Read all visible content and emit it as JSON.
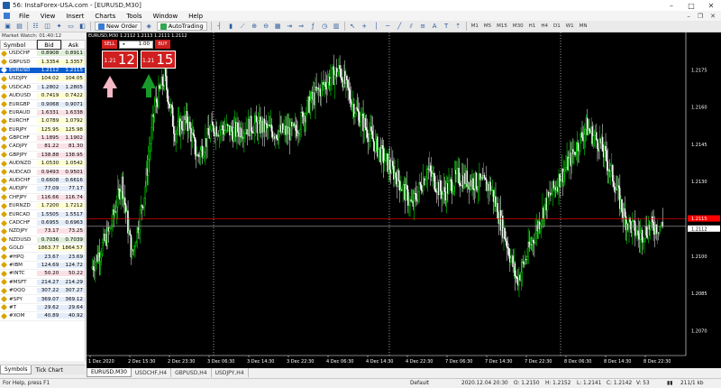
{
  "window": {
    "title": "56: InstaForex-USA.com - [EURUSD,M30]"
  },
  "menu": [
    "File",
    "View",
    "Insert",
    "Charts",
    "Tools",
    "Window",
    "Help"
  ],
  "toolbar": {
    "new_order": "New Order",
    "auto_trading": "AutoTrading",
    "timeframes": [
      "M1",
      "M5",
      "M15",
      "M30",
      "H1",
      "H4",
      "D1",
      "W1",
      "MN"
    ]
  },
  "market_watch": {
    "title": "Market Watch: 01:40:12",
    "headers": {
      "symbol": "Symbol",
      "bid": "Bid",
      "ask": "Ask"
    },
    "rows": [
      {
        "symbol": "USDCHF",
        "bid": "0.8908",
        "ask": "0.8911",
        "bg": "#dff0d8"
      },
      {
        "symbol": "GBPUSD",
        "bid": "1.3354",
        "ask": "1.3357",
        "bg": "#ffffd0"
      },
      {
        "symbol": "EURUSD",
        "bid": "1.2112",
        "ask": "1.2115",
        "bg": "#0a5dcf",
        "selected": true
      },
      {
        "symbol": "USDJPY",
        "bid": "104.02",
        "ask": "104.05",
        "bg": "#ffffd0"
      },
      {
        "symbol": "USDCAD",
        "bid": "1.2802",
        "ask": "1.2805",
        "bg": "#e3ecfa"
      },
      {
        "symbol": "AUDUSD",
        "bid": "0.7419",
        "ask": "0.7422",
        "bg": "#ffffd0"
      },
      {
        "symbol": "EURGBP",
        "bid": "0.9068",
        "ask": "0.9071",
        "bg": "#e3ecfa"
      },
      {
        "symbol": "EURAUD",
        "bid": "1.6331",
        "ask": "1.6338",
        "bg": "#fbe0e6"
      },
      {
        "symbol": "EURCHF",
        "bid": "1.0789",
        "ask": "1.0792",
        "bg": "#ffffd0"
      },
      {
        "symbol": "EURJPY",
        "bid": "125.95",
        "ask": "125.98",
        "bg": "#ffffd0"
      },
      {
        "symbol": "GBPCHF",
        "bid": "1.1895",
        "ask": "1.1902",
        "bg": "#fbe0e6"
      },
      {
        "symbol": "CADJPY",
        "bid": "81.22",
        "ask": "81.30",
        "bg": "#fbe0e6"
      },
      {
        "symbol": "GBPJPY",
        "bid": "138.88",
        "ask": "138.95",
        "bg": "#fbe0e6"
      },
      {
        "symbol": "AUDNZD",
        "bid": "1.0530",
        "ask": "1.0542",
        "bg": "#ffffd0"
      },
      {
        "symbol": "AUDCAD",
        "bid": "0.9493",
        "ask": "0.9501",
        "bg": "#fbe0e6"
      },
      {
        "symbol": "AUDCHF",
        "bid": "0.6608",
        "ask": "0.6616",
        "bg": "#e3ecfa"
      },
      {
        "symbol": "AUDJPY",
        "bid": "77.09",
        "ask": "77.17",
        "bg": "#e3ecfa"
      },
      {
        "symbol": "CHFJPY",
        "bid": "116.66",
        "ask": "116.74",
        "bg": "#fbe0e6"
      },
      {
        "symbol": "EURNZD",
        "bid": "1.7200",
        "ask": "1.7212",
        "bg": "#ffffd0"
      },
      {
        "symbol": "EURCAD",
        "bid": "1.5505",
        "ask": "1.5517",
        "bg": "#e3ecfa"
      },
      {
        "symbol": "CADCHF",
        "bid": "0.6955",
        "ask": "0.6963",
        "bg": "#e3ecfa"
      },
      {
        "symbol": "NZDJPY",
        "bid": "73.17",
        "ask": "73.25",
        "bg": "#fbe0e6"
      },
      {
        "symbol": "NZDUSD",
        "bid": "0.7036",
        "ask": "0.7039",
        "bg": "#dff0d8"
      },
      {
        "symbol": "GOLD",
        "bid": "1863.77",
        "ask": "1864.57",
        "bg": "#ffffd0"
      },
      {
        "symbol": "#HPQ",
        "bid": "23.67",
        "ask": "23.69",
        "bg": "#e3ecfa"
      },
      {
        "symbol": "#IBM",
        "bid": "124.69",
        "ask": "124.72",
        "bg": "#e3ecfa"
      },
      {
        "symbol": "#INTC",
        "bid": "50.20",
        "ask": "50.22",
        "bg": "#fbe0e6"
      },
      {
        "symbol": "#MSFT",
        "bid": "214.27",
        "ask": "214.29",
        "bg": "#e3ecfa"
      },
      {
        "symbol": "#QQQ",
        "bid": "307.22",
        "ask": "307.27",
        "bg": "#e3ecfa"
      },
      {
        "symbol": "#SPY",
        "bid": "369.07",
        "ask": "369.12",
        "bg": "#e3ecfa"
      },
      {
        "symbol": "#T",
        "bid": "29.62",
        "ask": "29.64",
        "bg": "#e3ecfa"
      },
      {
        "symbol": "#XOM",
        "bid": "40.89",
        "ask": "40.92",
        "bg": "#e3ecfa"
      }
    ],
    "tabs": [
      "Symbols",
      "Tick Chart"
    ]
  },
  "chart": {
    "header": "EURUSD,M30  1.2112 1.2113 1.2111 1.2112",
    "trade_panel": {
      "sell_label": "SELL",
      "buy_label": "BUY",
      "lot": "1.00",
      "sell_small": "1.21",
      "sell_big": "12",
      "buy_small": "1.21",
      "buy_big": "15"
    },
    "price_axis": [
      "1.2175",
      "1.2160",
      "1.2145",
      "1.2130",
      "1.2115",
      "1.2100",
      "1.2085",
      "1.2070"
    ],
    "time_axis": [
      "1 Dec 2020",
      "2 Dec 15:30",
      "2 Dec 23:30",
      "3 Dec 06:30",
      "3 Dec 14:30",
      "3 Dec 22:30",
      "4 Dec 06:30",
      "4 Dec 14:30",
      "4 Dec 22:30",
      "7 Dec 06:30",
      "7 Dec 14:30",
      "7 Dec 22:30",
      "8 Dec 06:30",
      "8 Dec 14:30",
      "8 Dec 22:30"
    ],
    "ask_tag": "1.2115",
    "bid_tag": "1.2112",
    "tabs": [
      "EURUSD,M30",
      "USDCHF,H4",
      "GBPUSD,H4",
      "USDJPY,H4"
    ],
    "colors": {
      "bull": "#00ff00",
      "bear": "#ffffff",
      "ask_line": "#ff0000",
      "bid_line": "#aaaaaa"
    }
  },
  "status": {
    "help": "For Help, press F1",
    "profile": "Default",
    "datetime": "2020.12.04 20:30",
    "open": "O: 1.2150",
    "high": "H: 1.2152",
    "low": "L: 1.2141",
    "close": "C: 1.2142",
    "volume": "V: 53",
    "traffic": "211/1 kb"
  }
}
